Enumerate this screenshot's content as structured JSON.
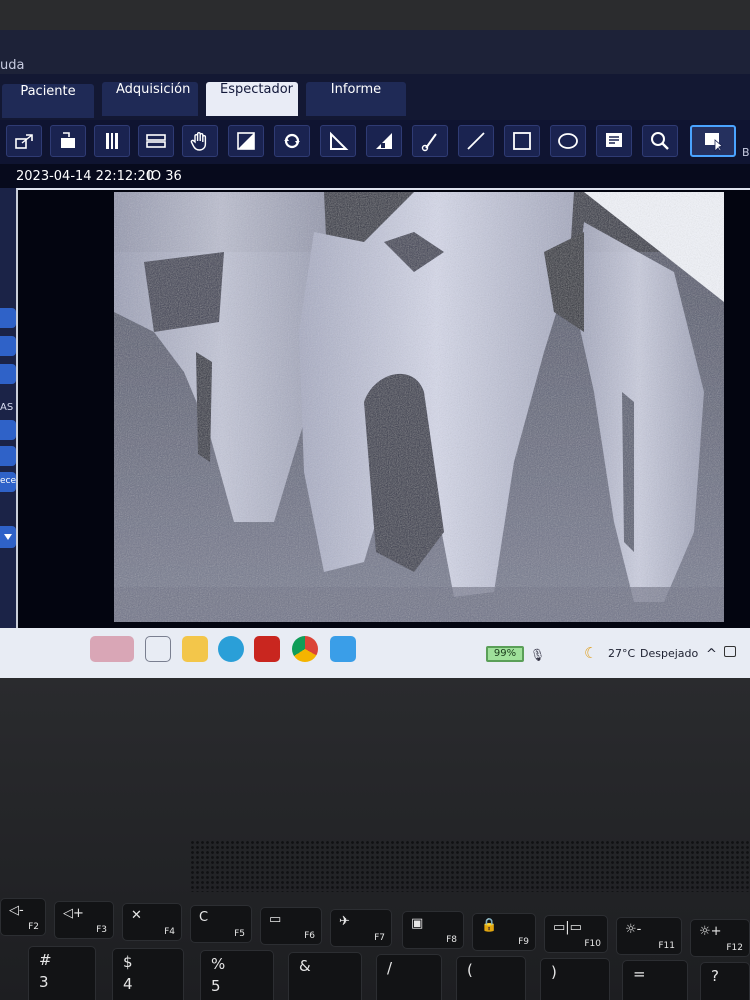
{
  "menu": {
    "partial_text": "uda"
  },
  "tabs": [
    {
      "label": "Paciente",
      "active": false
    },
    {
      "label": "Adquisición",
      "active": false
    },
    {
      "label": "Espectador",
      "active": true
    },
    {
      "label": "Informe",
      "active": false
    }
  ],
  "toolbar": {
    "tools": [
      {
        "icon": "import-icon"
      },
      {
        "icon": "export-icon"
      },
      {
        "icon": "compare-icon"
      },
      {
        "icon": "split-view-icon"
      },
      {
        "icon": "pan-hand-icon"
      },
      {
        "icon": "contrast-icon"
      },
      {
        "icon": "rotate-icon"
      },
      {
        "icon": "angle-icon"
      },
      {
        "icon": "brightness-icon"
      },
      {
        "icon": "probe-icon"
      },
      {
        "icon": "line-icon"
      },
      {
        "icon": "rectangle-icon"
      },
      {
        "icon": "ellipse-icon"
      },
      {
        "icon": "annotation-icon"
      },
      {
        "icon": "zoom-icon"
      },
      {
        "icon": "select-icon"
      }
    ],
    "partial_label": "B"
  },
  "image_info": {
    "datetime": "2023-04-14 22:12:20",
    "sensor": "IO 36"
  },
  "side_panel": {
    "labels": [
      "AS",
      "ecer"
    ]
  },
  "taskbar": {
    "battery": "99%",
    "temperature": "27°C",
    "weather": "Despejado",
    "chevron": "^"
  },
  "keyboard": {
    "fn_row": [
      {
        "glyph": "◁-",
        "fkey": "F2"
      },
      {
        "glyph": "◁+",
        "fkey": "F3"
      },
      {
        "glyph": "✕",
        "fkey": "F4"
      },
      {
        "glyph": "C",
        "fkey": "F5"
      },
      {
        "glyph": "▭",
        "fkey": "F6"
      },
      {
        "glyph": "✈",
        "fkey": "F7"
      },
      {
        "glyph": "▣",
        "fkey": "F8"
      },
      {
        "glyph": "🔒",
        "fkey": "F9"
      },
      {
        "glyph": "▭|▭",
        "fkey": "F10"
      },
      {
        "glyph": "☼-",
        "fkey": "F11"
      },
      {
        "glyph": "☼+",
        "fkey": "F12"
      }
    ],
    "num_row": [
      {
        "top": "#",
        "bottom": "3"
      },
      {
        "top": "$",
        "bottom": "4"
      },
      {
        "top": "%",
        "bottom": "5"
      },
      {
        "top": "&",
        "bottom": ""
      },
      {
        "top": "/",
        "bottom": ""
      },
      {
        "top": "(",
        "bottom": ""
      },
      {
        "top": ")",
        "bottom": ""
      },
      {
        "top": "=",
        "bottom": ""
      },
      {
        "top": "?",
        "bottom": ""
      }
    ]
  }
}
